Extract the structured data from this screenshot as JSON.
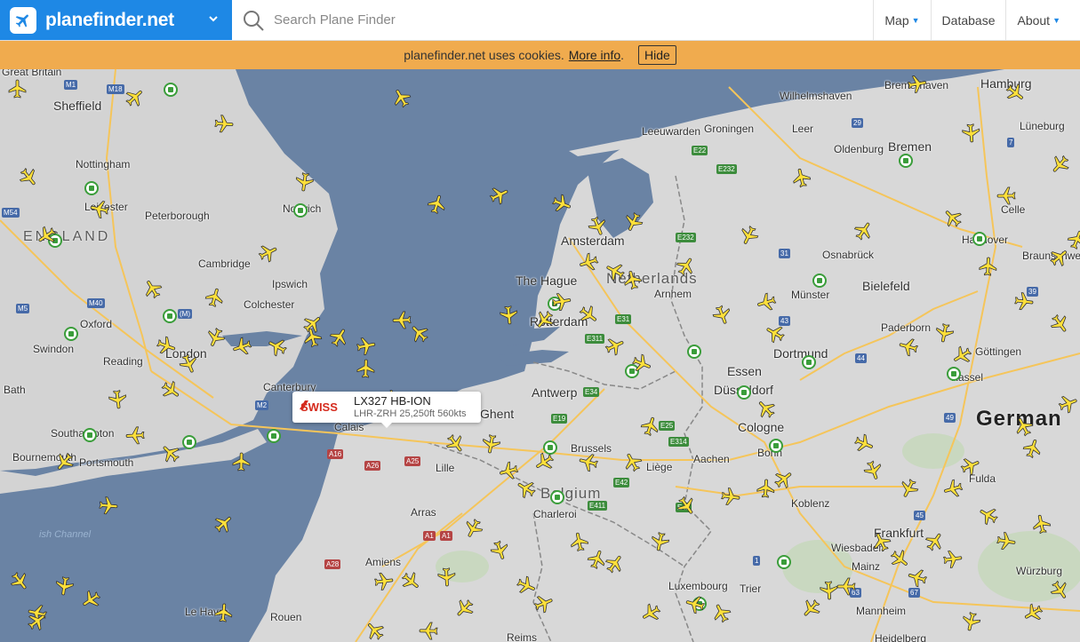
{
  "header": {
    "brand": "planefinder.net",
    "search_placeholder": "Search Plane Finder",
    "nav": [
      {
        "label": "Map",
        "has_dropdown": true
      },
      {
        "label": "Database",
        "has_dropdown": false
      },
      {
        "label": "About",
        "has_dropdown": true
      }
    ]
  },
  "cookie_bar": {
    "text": "planefinder.net uses cookies.",
    "link": "More info",
    "suffix": ".",
    "hide_label": "Hide"
  },
  "tooltip": {
    "airline": "SWISS",
    "title": "LX327 HB-ION",
    "subtitle": "LHR-ZRH 25,250ft 560kts"
  },
  "map": {
    "countries": [
      "ENGLAND",
      "Netherlands",
      "Belgium",
      "German"
    ],
    "sea_label": "ish Channel",
    "cities": [
      "Sheffield",
      "Nottingham",
      "Leicester",
      "Peterborough",
      "Norwich",
      "Cambridge",
      "Ipswich",
      "Colchester",
      "Oxford",
      "Swindon",
      "Reading",
      "Bath",
      "London",
      "Canterbury",
      "Southampton",
      "Bournemouth",
      "Portsmouth",
      "Calais",
      "Lille",
      "Arras",
      "Amiens",
      "Rouen",
      "Le Havre",
      "Reims",
      "Great Britain",
      "Wilhelmshaven",
      "Bremerhaven",
      "Hamburg",
      "Groningen",
      "Leeuwarden",
      "Leer",
      "Oldenburg",
      "Bremen",
      "Lüneburg",
      "Celle",
      "Hannover",
      "Braunschweig",
      "Osnabrück",
      "Bielefeld",
      "Münster",
      "Paderborn",
      "Göttingen",
      "Kassel",
      "Dortmund",
      "Essen",
      "Düsseldorf",
      "Cologne",
      "Bonn",
      "Aachen",
      "Amsterdam",
      "The Hague",
      "Rotterdam",
      "Arnhem",
      "Antwerp",
      "Ghent",
      "Brussels",
      "Charleroi",
      "Liège",
      "Luxembourg",
      "Trier",
      "Koblenz",
      "Wiesbaden",
      "Frankfurt",
      "Mainz",
      "Mannheim",
      "Heidelberg",
      "Würzburg",
      "Fulda",
      "Belgium"
    ]
  }
}
